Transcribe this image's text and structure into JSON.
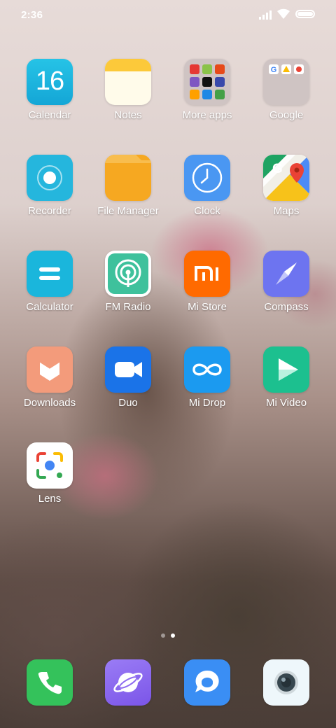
{
  "status": {
    "time": "2:36"
  },
  "calendar_date": "16",
  "apps": [
    {
      "label": "Calendar"
    },
    {
      "label": "Notes"
    },
    {
      "label": "More apps"
    },
    {
      "label": "Google"
    },
    {
      "label": "Recorder"
    },
    {
      "label": "File Manager"
    },
    {
      "label": "Clock"
    },
    {
      "label": "Maps"
    },
    {
      "label": "Calculator"
    },
    {
      "label": "FM Radio"
    },
    {
      "label": "Mi Store"
    },
    {
      "label": "Compass"
    },
    {
      "label": "Downloads"
    },
    {
      "label": "Duo"
    },
    {
      "label": "Mi Drop"
    },
    {
      "label": "Mi Video"
    },
    {
      "label": "Lens"
    }
  ],
  "page_indicator": {
    "pages": 2,
    "active": 2
  },
  "dock": [
    {
      "icon": "phone-icon"
    },
    {
      "icon": "browser-icon"
    },
    {
      "icon": "messaging-icon"
    },
    {
      "icon": "camera-icon"
    }
  ],
  "colors": {
    "calendar": "#1ab6dc",
    "notes_top": "#fcc93a",
    "recorder": "#25b6dd",
    "file_manager": "#f6a821",
    "clock": "#4a97f2",
    "calculator": "#1ab6dc",
    "fm_radio": "#3ec19c",
    "mi_store": "#ff6a00",
    "compass": "#6d74f0",
    "downloads": "#f39b7b",
    "duo": "#1a73e8",
    "mi_drop": "#1b9af0",
    "mi_video": "#1cc08f",
    "phone": "#34c25b",
    "browser": "#8f6cf0",
    "messaging": "#3a8ef4"
  }
}
